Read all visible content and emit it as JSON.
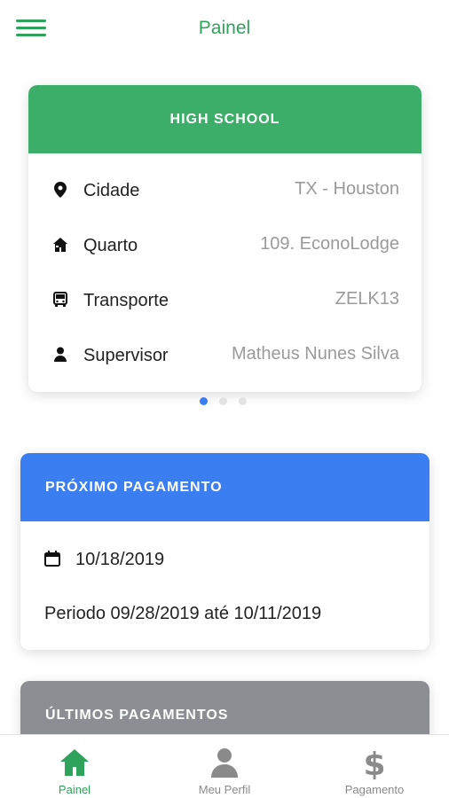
{
  "header": {
    "title": "Painel",
    "menu_icon": "hamburger-menu-icon"
  },
  "school_card": {
    "title": "HIGH SCHOOL",
    "rows": [
      {
        "icon": "location-pin-icon",
        "label": "Cidade",
        "value": "TX - Houston"
      },
      {
        "icon": "hotel-icon",
        "label": "Quarto",
        "value": "109. EconoLodge"
      },
      {
        "icon": "bus-icon",
        "label": "Transporte",
        "value": "ZELK13"
      },
      {
        "icon": "person-icon",
        "label": "Supervisor",
        "value": "Matheus Nunes Silva"
      }
    ]
  },
  "carousel": {
    "page_count": 3,
    "active_index": 0
  },
  "next_payment": {
    "title": "PRÓXIMO PAGAMENTO",
    "date": "10/18/2019",
    "period": "Periodo 09/28/2019 até 10/11/2019"
  },
  "last_payments": {
    "title": "ÚLTIMOS PAGAMENTOS"
  },
  "tabs": [
    {
      "icon": "home-icon",
      "label": "Painel",
      "active": true
    },
    {
      "icon": "profile-icon",
      "label": "Meu Perfil",
      "active": false
    },
    {
      "icon": "dollar-icon",
      "label": "Pagamento",
      "active": false
    }
  ],
  "colors": {
    "brand_green": "#2fa25c",
    "card_green": "#3dae6a",
    "payment_blue": "#3a7ef2",
    "history_gray": "#8c8e93"
  }
}
